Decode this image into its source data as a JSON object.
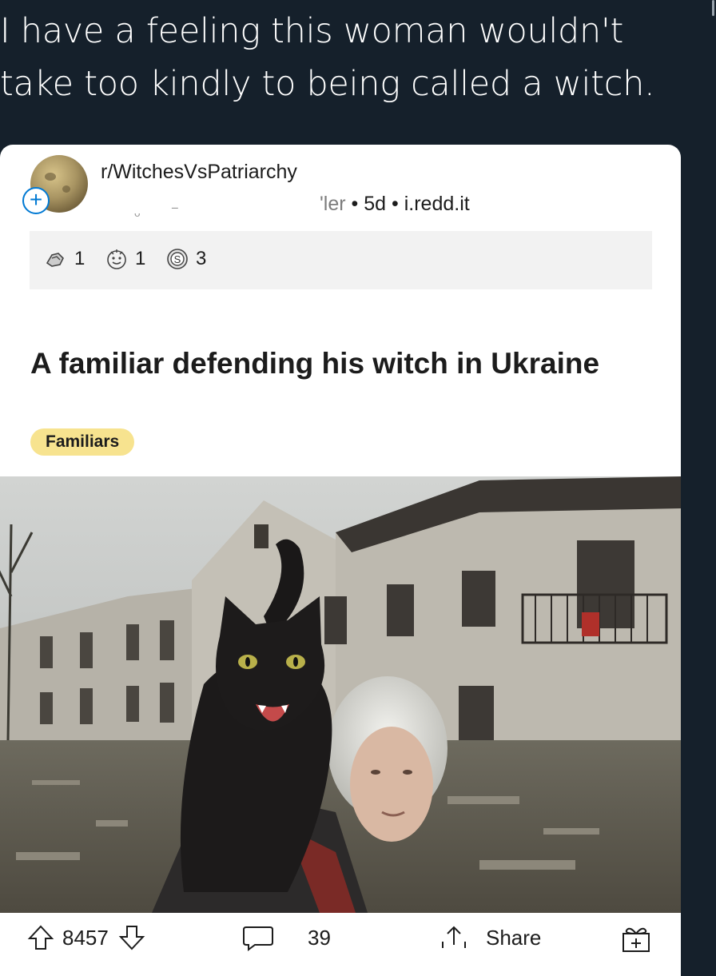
{
  "tweet": {
    "text_line1": "I have a feeling this woman wouldn't",
    "text_line2": "take too kindly to being called a witch."
  },
  "post": {
    "subreddit": "r/WitchesVsPatriarchy",
    "meta_user_fragment": "'ler",
    "meta_age": "5d",
    "meta_domain": "i.redd.it",
    "meta_separator": "•",
    "join_icon": "plus-icon",
    "awards": [
      {
        "icon": "award-hug-icon",
        "count": "1"
      },
      {
        "icon": "award-wholesome-icon",
        "count": "1"
      },
      {
        "icon": "award-silver-icon",
        "count": "3"
      }
    ],
    "title": "A familiar defending his witch in Ukraine",
    "flair": "Familiars",
    "flair_color": "#f7e38f",
    "image_description_icon": "photo-black-cat-on-elderly-woman-ruined-building"
  },
  "actions": {
    "upvotes": "8457",
    "comments": "39",
    "share": "Share",
    "upvote_icon": "upvote-arrow-icon",
    "downvote_icon": "downvote-arrow-icon",
    "comment_icon": "comment-bubble-icon",
    "share_icon": "share-icon",
    "award_icon": "gift-award-icon"
  },
  "colors": {
    "background": "#15202b",
    "card": "#ffffff",
    "accent": "#0079d3"
  }
}
